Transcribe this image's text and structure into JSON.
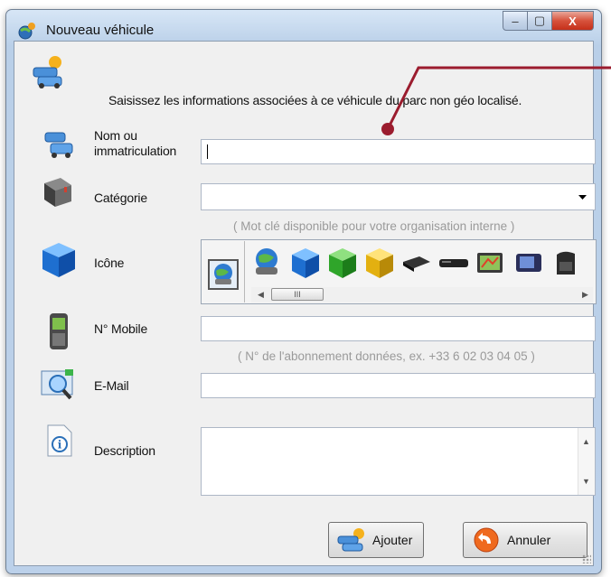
{
  "window": {
    "title": "Nouveau véhicule",
    "close_glyph": "X",
    "minimize_glyph": "–",
    "maximize_glyph": "▢"
  },
  "intro_text": "Saisissez les informations associées à ce véhicule du parc non géo localisé.",
  "fields": {
    "name": {
      "label_line1": "Nom ou",
      "label_line2": "immatriculation",
      "value": ""
    },
    "category": {
      "label": "Catégorie",
      "value": "",
      "hint": "( Mot clé disponible pour votre organisation interne )"
    },
    "icon": {
      "label": "Icône",
      "scroll_grip": "III"
    },
    "mobile": {
      "label": "N° Mobile",
      "value": "",
      "hint": "( N° de l'abonnement données, ex. +33 6 02 03 04 05 )"
    },
    "email": {
      "label": "E-Mail",
      "value": ""
    },
    "description": {
      "label": "Description",
      "value": ""
    }
  },
  "icon_choices": [
    "globe-car-icon",
    "blue-cube-icon",
    "green-cube-icon",
    "yellow-cube-icon",
    "gps-tracker-icon",
    "gps-box-icon",
    "gps-screen-icon",
    "pda-icon",
    "handheld-terminal-icon"
  ],
  "buttons": {
    "add": "Ajouter",
    "cancel": "Annuler"
  },
  "colors": {
    "accent_annotation": "#9b1c2e"
  }
}
